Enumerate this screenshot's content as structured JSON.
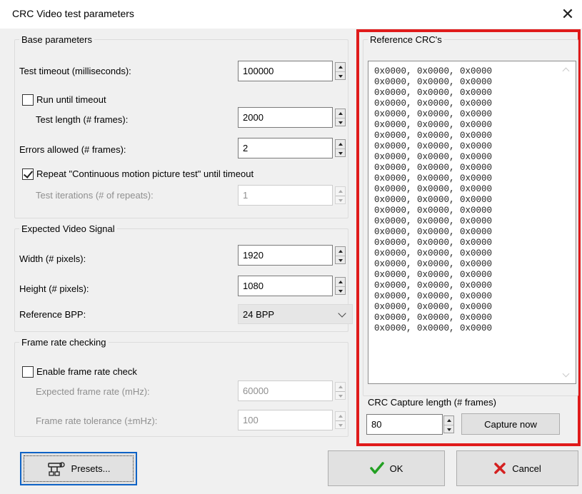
{
  "window": {
    "title": "CRC Video test parameters",
    "close_glyph": "✕"
  },
  "base": {
    "legend": "Base parameters",
    "timeout_label": "Test timeout (milliseconds):",
    "timeout_value": "100000",
    "run_until_label": "Run until timeout",
    "run_until_checked": false,
    "length_label": "Test length (# frames):",
    "length_value": "2000",
    "errors_label": "Errors allowed (# frames):",
    "errors_value": "2",
    "repeat_label": "Repeat \"Continuous motion picture test\" until timeout",
    "repeat_checked": true,
    "iterations_label": "Test iterations (# of repeats):",
    "iterations_value": "1"
  },
  "signal": {
    "legend": "Expected Video Signal",
    "width_label": "Width (# pixels):",
    "width_value": "1920",
    "height_label": "Height (# pixels):",
    "height_value": "1080",
    "bpp_label": "Reference BPP:",
    "bpp_value": "24 BPP"
  },
  "framerate": {
    "legend": "Frame rate checking",
    "enable_label": "Enable frame rate check",
    "enable_checked": false,
    "expected_label": "Expected frame rate (mHz):",
    "expected_value": "60000",
    "tolerance_label": "Frame rate tolerance (±mHz):",
    "tolerance_value": "100"
  },
  "reference": {
    "legend": "Reference CRC's",
    "crc_text": "0x0000, 0x0000, 0x0000\n0x0000, 0x0000, 0x0000\n0x0000, 0x0000, 0x0000\n0x0000, 0x0000, 0x0000\n0x0000, 0x0000, 0x0000\n0x0000, 0x0000, 0x0000\n0x0000, 0x0000, 0x0000\n0x0000, 0x0000, 0x0000\n0x0000, 0x0000, 0x0000\n0x0000, 0x0000, 0x0000\n0x0000, 0x0000, 0x0000\n0x0000, 0x0000, 0x0000\n0x0000, 0x0000, 0x0000\n0x0000, 0x0000, 0x0000\n0x0000, 0x0000, 0x0000\n0x0000, 0x0000, 0x0000\n0x0000, 0x0000, 0x0000\n0x0000, 0x0000, 0x0000\n0x0000, 0x0000, 0x0000\n0x0000, 0x0000, 0x0000\n0x0000, 0x0000, 0x0000\n0x0000, 0x0000, 0x0000\n0x0000, 0x0000, 0x0000\n0x0000, 0x0000, 0x0000\n0x0000, 0x0000, 0x0000",
    "capture_length_label": "CRC Capture length (# frames)",
    "capture_length_value": "80",
    "capture_now_label": "Capture now",
    "highlight_color": "#e01b1b"
  },
  "buttons": {
    "presets_label": "Presets...",
    "ok_label": "OK",
    "cancel_label": "Cancel"
  },
  "icons": {
    "presets": "presets-tool-icon",
    "ok": "green-check-icon",
    "cancel": "red-x-icon"
  }
}
